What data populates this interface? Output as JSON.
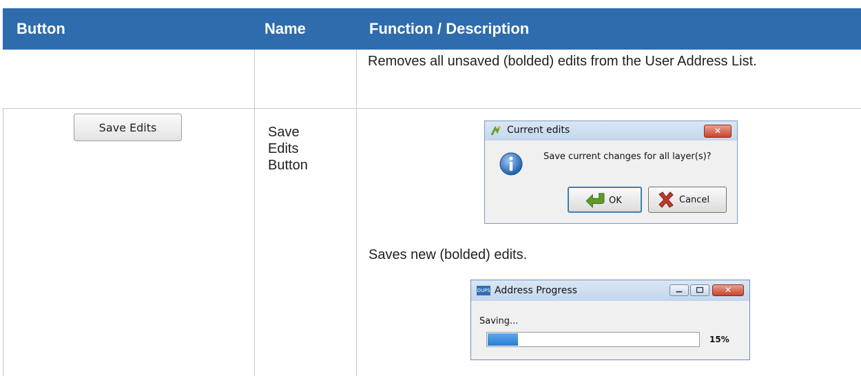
{
  "table": {
    "headers": [
      "Button",
      "Name",
      "Function / Description"
    ],
    "row1": {
      "description": "Removes all unsaved (bolded) edits from the User Address List."
    },
    "row2": {
      "button_label": "Save Edits",
      "name_lines": [
        "Save",
        "Edits",
        "Button"
      ],
      "description": "Saves new (bolded) edits."
    }
  },
  "dialog_confirm": {
    "title": "Current edits",
    "message": "Save current changes for all layer(s)?",
    "ok_label": "OK",
    "cancel_label": "Cancel",
    "close_glyph": "✕",
    "icons": [
      "app-icon",
      "info-icon",
      "ok-arrow-icon",
      "cancel-x-icon"
    ]
  },
  "dialog_progress": {
    "title": "Address Progress",
    "app_icon_text": "OUPS",
    "status": "Saving...",
    "progress_percent": 15,
    "progress_label": "15%",
    "close_glyph": "✕"
  },
  "colors": {
    "header_bg": "#2e6cad",
    "header_text": "#ffffff",
    "progress_fill": "#2b7bd2"
  }
}
